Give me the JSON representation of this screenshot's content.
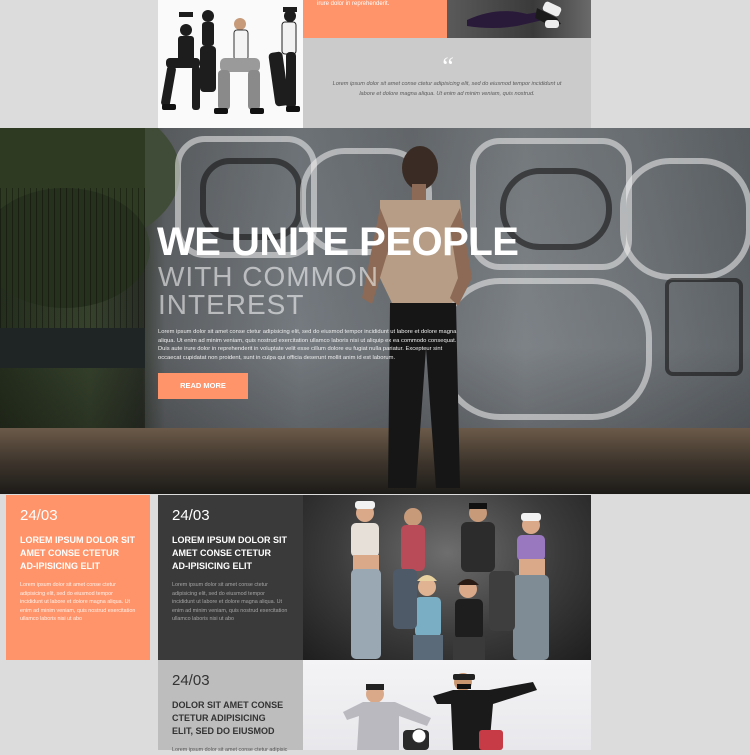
{
  "top": {
    "orange_card_text": "irure dolor in reprehenderit.",
    "quote_mark": "“",
    "quote_text": "Lorem ipsum dolor sit amet conse ctetur adipisicing elit, sed do eiusmod tempor incididunt ut labore et dolore magna aliqua. Ut enim ad minim veniam, quis nostrud."
  },
  "hero": {
    "title": "WE UNITE PEOPLE",
    "subtitle": "WITH COMMON INTEREST",
    "body": "Lorem ipsum dolor sit amet conse ctetur adipisicing elit, sed do eiusmod tempor incididunt ut labore et dolore magna aliqua. Ut enim ad minim veniam, quis nostrud exercitation ullamco laboris nisi ut aliquip ex ea commodo consequat. Duis aute irure dolor in reprehenderit in voluptate velit esse cillum dolore eu fugiat nulla pariatur. Excepteur sint occaecat cupidatat non proident, sunt in culpa qui officia deserunt mollit anim id est laborum.",
    "button_label": "READ MORE"
  },
  "news": [
    {
      "date": "24/03",
      "title": "LOREM IPSUM DOLOR SIT AMET CONSE CTETUR AD-IPISICING ELIT",
      "text": "Lorem ipsum dolor sit amet conse ctetur adipisicing elit, sed do eiusmod tempor incididunt ut labore et dolore magna aliqua. Ut enim ad minim veniam, quis nostrud exercitation ullamco laboris nisi ut abo"
    },
    {
      "date": "24/03",
      "title": "LOREM IPSUM DOLOR SIT AMET CONSE CTETUR AD-IPISICING ELIT",
      "text": "Lorem ipsum dolor sit amet conse ctetur adipisicing elit, sed do eiusmod tempor incididunt ut labore et dolore magna aliqua. Ut enim ad minim veniam, quis nostrud exercitation ullamco laboris nisi ut abo"
    },
    {
      "date": "24/03",
      "title": "DOLOR SIT AMET CONSE CTETUR ADIPISICING ELIT, SED DO EIUSMOD",
      "text": "Lorem ipsum dolor sit amet conse ctetur adipisic"
    }
  ],
  "colors": {
    "accent": "#ff946b",
    "dark_card": "#3a3a3a",
    "grey_card": "#bdbdbd",
    "page_bg": "#dcdcdc"
  }
}
